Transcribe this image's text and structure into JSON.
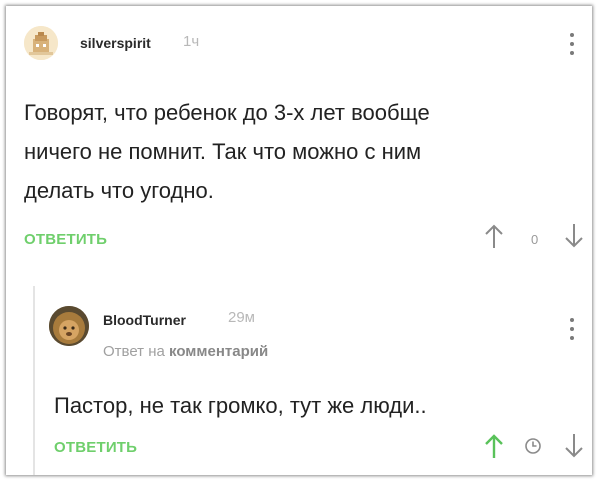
{
  "comment": {
    "author": "silverspirit",
    "time": "1ч",
    "text_lines": [
      "Говорят, что ребенок до 3-х лет вообще",
      "ничего не помнит. Так что можно с ним",
      "делать что угодно."
    ],
    "reply_label": "ОТВЕТИТЬ",
    "score": "0"
  },
  "reply": {
    "author": "BloodTurner",
    "time": "29м",
    "reply_to_prefix": "Ответ на",
    "reply_to_link": "комментарий",
    "text": "Пастор, не так громко, тут же люди..",
    "reply_label": "ОТВЕТИТЬ"
  },
  "colors": {
    "accent_green": "#6fcf6c",
    "upvoted_green": "#59c25a",
    "muted_gray": "#a0a0a0"
  },
  "icons": [
    "more-vertical-icon",
    "arrow-up-icon",
    "arrow-down-icon",
    "clock-icon"
  ]
}
